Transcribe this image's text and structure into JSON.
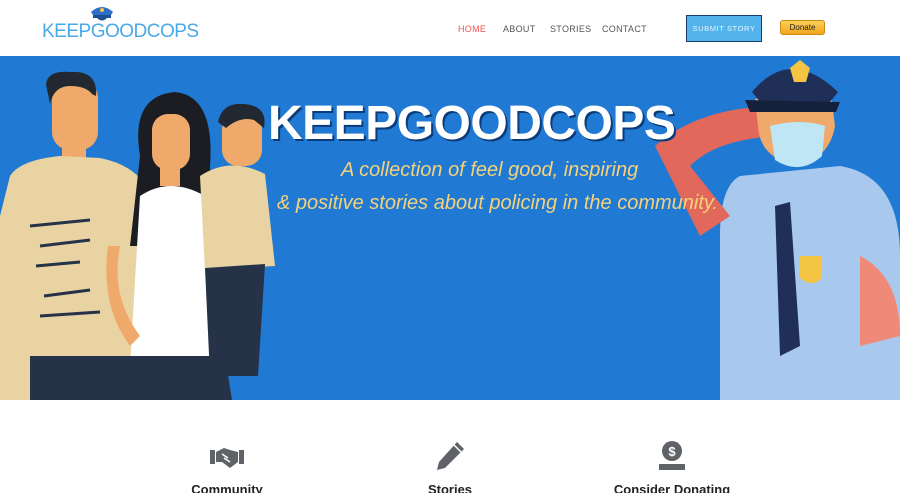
{
  "header": {
    "logo_text": "KEEPGOODCOPS",
    "nav": [
      {
        "label": "HOME",
        "active": true
      },
      {
        "label": "ABOUT",
        "active": false
      },
      {
        "label": "STORIES",
        "active": false
      },
      {
        "label": "CONTACT",
        "active": false
      }
    ],
    "submit_label": "SUBMIT STORY",
    "donate_label": "Donate"
  },
  "hero": {
    "title": "KEEPGOODCOPS",
    "subtitle_line1": "A collection of feel good, inspiring",
    "subtitle_line2": "& positive stories about policing in the community."
  },
  "features": [
    {
      "label": "Community",
      "icon": "handshake-icon"
    },
    {
      "label": "Stories",
      "icon": "pencil-icon"
    },
    {
      "label": "Consider Donating",
      "icon": "dollar-hand-icon"
    }
  ],
  "colors": {
    "hero_bg": "#2079d3",
    "accent_active": "#ef5350",
    "subtitle": "#f5d27a",
    "logo": "#4aa9e8"
  }
}
